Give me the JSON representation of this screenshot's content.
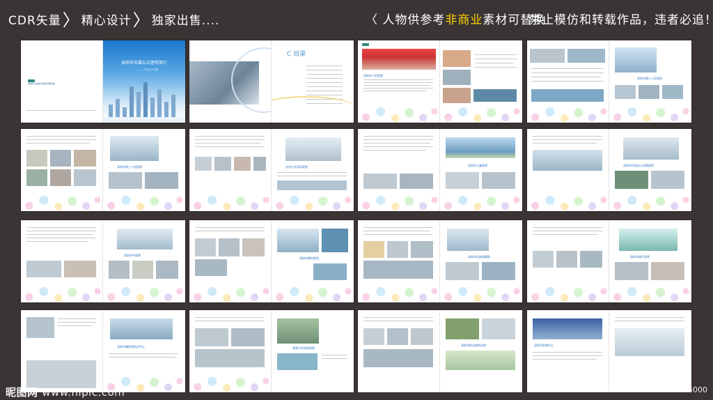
{
  "header": {
    "seg1": "CDR矢量",
    "seg2": "精心设计",
    "seg3": "独家出售....",
    "right_prefix": "〈 人物供参考",
    "right_highlight": "非商业",
    "right_suffix": "素材可替换",
    "notice": "禁止模仿和转载作品，违者必追！）",
    "highlight_color": "#ffd100"
  },
  "brochure": {
    "cover_title": "深圳市市属公立医院简介",
    "cover_subtitle": "—— 市卫生计生委",
    "cover_small_text": "深圳市卫生和计划生育委员会",
    "contents_heading": "C 目录",
    "spreads_count": 16,
    "section_captions": [
      "深圳市人民医院",
      "深圳市第二人民医院",
      "深圳市第三人民医院",
      "北京大学深圳医院",
      "深圳市儿童医院",
      "深圳市孙逸仙心血管医院",
      "深圳市中医院",
      "深圳市眼科医院",
      "深圳市妇幼保健院",
      "深圳市康宁医院",
      "深圳市慢性病防治中心",
      "香港大学深圳医院",
      "深圳市职业病防治院",
      "深圳市急救中心"
    ],
    "accent_color": "#2f70c7"
  },
  "footer": {
    "brand": "昵图网",
    "site": "www.nipic.com",
    "id_text": "ID:9360587 NO:20150828145709584000"
  }
}
